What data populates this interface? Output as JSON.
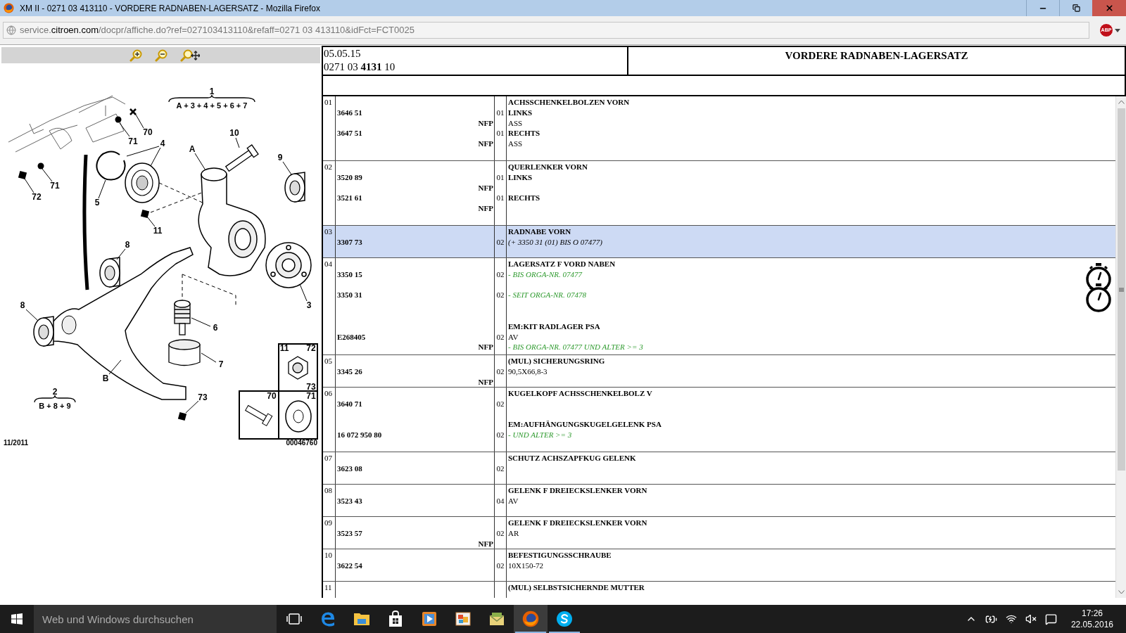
{
  "window": {
    "title": "XM II - 0271 03 413110 - VORDERE RADNABEN-LAGERSATZ - Mozilla Firefox"
  },
  "address_bar": {
    "url": "service.**citroen.com**/docpr/affiche.do?ref=027103413110&refaff=0271 03 413110&idFct=FCT0025",
    "addon_badge": "ABP"
  },
  "diagram": {
    "assemblies": [
      {
        "number": "1",
        "formula": "A + 3 + 4 + 5 + 6 + 7"
      },
      {
        "number": "2",
        "formula": "B + 8 + 9"
      }
    ],
    "callouts": [
      "70",
      "71",
      "4",
      "10",
      "9",
      "A",
      "72",
      "71",
      "5",
      "11",
      "8",
      "8",
      "6",
      "3",
      "B",
      "7",
      "73",
      "11",
      "72",
      "73",
      "70",
      "71"
    ],
    "date": "11/2011",
    "reference": "00046760"
  },
  "header": {
    "date": "05.05.15",
    "reference": "0271 03 **4131** 10",
    "title": "VORDERE RADNABEN-LAGERSATZ"
  },
  "parts": [
    {
      "index": "01",
      "selected": false,
      "lines": [
        {
          "kind": "heading",
          "text": "ACHSSCHENKELBOLZEN VORN"
        },
        {
          "kind": "heading",
          "part": "3646 51",
          "qty": "01",
          "text": "LINKS"
        },
        {
          "kind": "plain",
          "nfp": "NFP",
          "text": "ASS"
        },
        {
          "kind": "heading",
          "part": "3647 51",
          "qty": "01",
          "text": "RECHTS"
        },
        {
          "kind": "plain",
          "nfp": "NFP",
          "text": "ASS"
        }
      ]
    },
    {
      "index": "02",
      "selected": false,
      "lines": [
        {
          "kind": "heading",
          "text": "QUERLENKER VORN"
        },
        {
          "kind": "heading",
          "part": "3520 89",
          "qty": "01",
          "text": "LINKS"
        },
        {
          "kind": "plain",
          "nfp": "NFP"
        },
        {
          "kind": "heading",
          "part": "3521 61",
          "qty": "01",
          "text": "RECHTS"
        },
        {
          "kind": "plain",
          "nfp": "NFP"
        }
      ]
    },
    {
      "index": "03",
      "selected": true,
      "lines": [
        {
          "kind": "heading",
          "text": "RADNABE VORN"
        },
        {
          "kind": "note",
          "part": "3307 73",
          "qty": "02",
          "text": "(+ 3350 31 (01) BIS O 07477)"
        }
      ]
    },
    {
      "index": "04",
      "selected": false,
      "lines": [
        {
          "kind": "heading",
          "text": "LAGERSATZ F VORD NABEN"
        },
        {
          "kind": "variant",
          "part": "3350 15",
          "qty": "02",
          "text": "- BIS ORGA-NR. 07477",
          "stopwatch": true
        },
        {
          "kind": "spacer"
        },
        {
          "kind": "variant",
          "part": "3350 31",
          "qty": "02",
          "text": "- SEIT ORGA-NR. 07478",
          "stopwatch": true
        },
        {
          "kind": "spacer"
        },
        {
          "kind": "spacer"
        },
        {
          "kind": "heading",
          "text": "EM:KIT RADLAGER PSA"
        },
        {
          "kind": "plain",
          "part": "E268405",
          "qty": "02",
          "text": "AV"
        },
        {
          "kind": "variant",
          "nfp": "NFP",
          "text": "- BIS ORGA-NR. 07477 UND ALTER >= 3"
        }
      ]
    },
    {
      "index": "05",
      "selected": false,
      "lines": [
        {
          "kind": "heading",
          "text": "(MUL) SICHERUNGSRING"
        },
        {
          "kind": "plain",
          "part": "3345 26",
          "qty": "02",
          "text": "90,5X66,8-3"
        },
        {
          "kind": "plain",
          "nfp": "NFP"
        }
      ]
    },
    {
      "index": "06",
      "selected": false,
      "lines": [
        {
          "kind": "heading",
          "text": "KUGELKOPF ACHSSCHENKELBOLZ V"
        },
        {
          "kind": "plain",
          "part": "3640 71",
          "qty": "02"
        },
        {
          "kind": "spacer"
        },
        {
          "kind": "heading",
          "text": "EM:AUFHÄNGUNGSKUGELGELENK PSA"
        },
        {
          "kind": "variant",
          "part": "16 072 950 80",
          "qty": "02",
          "text": "- UND ALTER >= 3"
        }
      ]
    },
    {
      "index": "07",
      "selected": false,
      "lines": [
        {
          "kind": "heading",
          "text": "SCHUTZ ACHSZAPFKUG GELENK"
        },
        {
          "kind": "plain",
          "part": "3623 08",
          "qty": "02"
        }
      ]
    },
    {
      "index": "08",
      "selected": false,
      "lines": [
        {
          "kind": "heading",
          "text": "GELENK F DREIECKSLENKER VORN"
        },
        {
          "kind": "plain",
          "part": "3523 43",
          "qty": "04",
          "text": "AV"
        }
      ]
    },
    {
      "index": "09",
      "selected": false,
      "lines": [
        {
          "kind": "heading",
          "text": "GELENK F DREIECKSLENKER VORN"
        },
        {
          "kind": "plain",
          "part": "3523 57",
          "qty": "02",
          "text": "AR"
        },
        {
          "kind": "plain",
          "nfp": "NFP"
        }
      ]
    },
    {
      "index": "10",
      "selected": false,
      "lines": [
        {
          "kind": "heading",
          "text": "BEFESTIGUNGSSCHRAUBE"
        },
        {
          "kind": "plain",
          "part": "3622 54",
          "qty": "02",
          "text": "10X150-72"
        }
      ]
    },
    {
      "index": "11",
      "selected": false,
      "lines": [
        {
          "kind": "heading",
          "text": "(MUL) SELBSTSICHERNDE MUTTER"
        }
      ]
    }
  ],
  "taskbar": {
    "search": {
      "placeholder": "Web und Windows durchsuchen"
    },
    "apps": [
      {
        "kind": "taskview",
        "selected": false,
        "running": false
      },
      {
        "kind": "edge",
        "selected": false,
        "running": false
      },
      {
        "kind": "folder",
        "selected": false,
        "running": false
      },
      {
        "kind": "store",
        "selected": false,
        "running": false
      },
      {
        "kind": "media",
        "selected": false,
        "running": false
      },
      {
        "kind": "photos",
        "selected": false,
        "running": false
      },
      {
        "kind": "mail",
        "selected": false,
        "running": false
      },
      {
        "kind": "firefox",
        "selected": true,
        "running": true
      },
      {
        "kind": "skype",
        "selected": false,
        "running": true
      }
    ],
    "time": "17:26",
    "date": "22.05.2016"
  }
}
